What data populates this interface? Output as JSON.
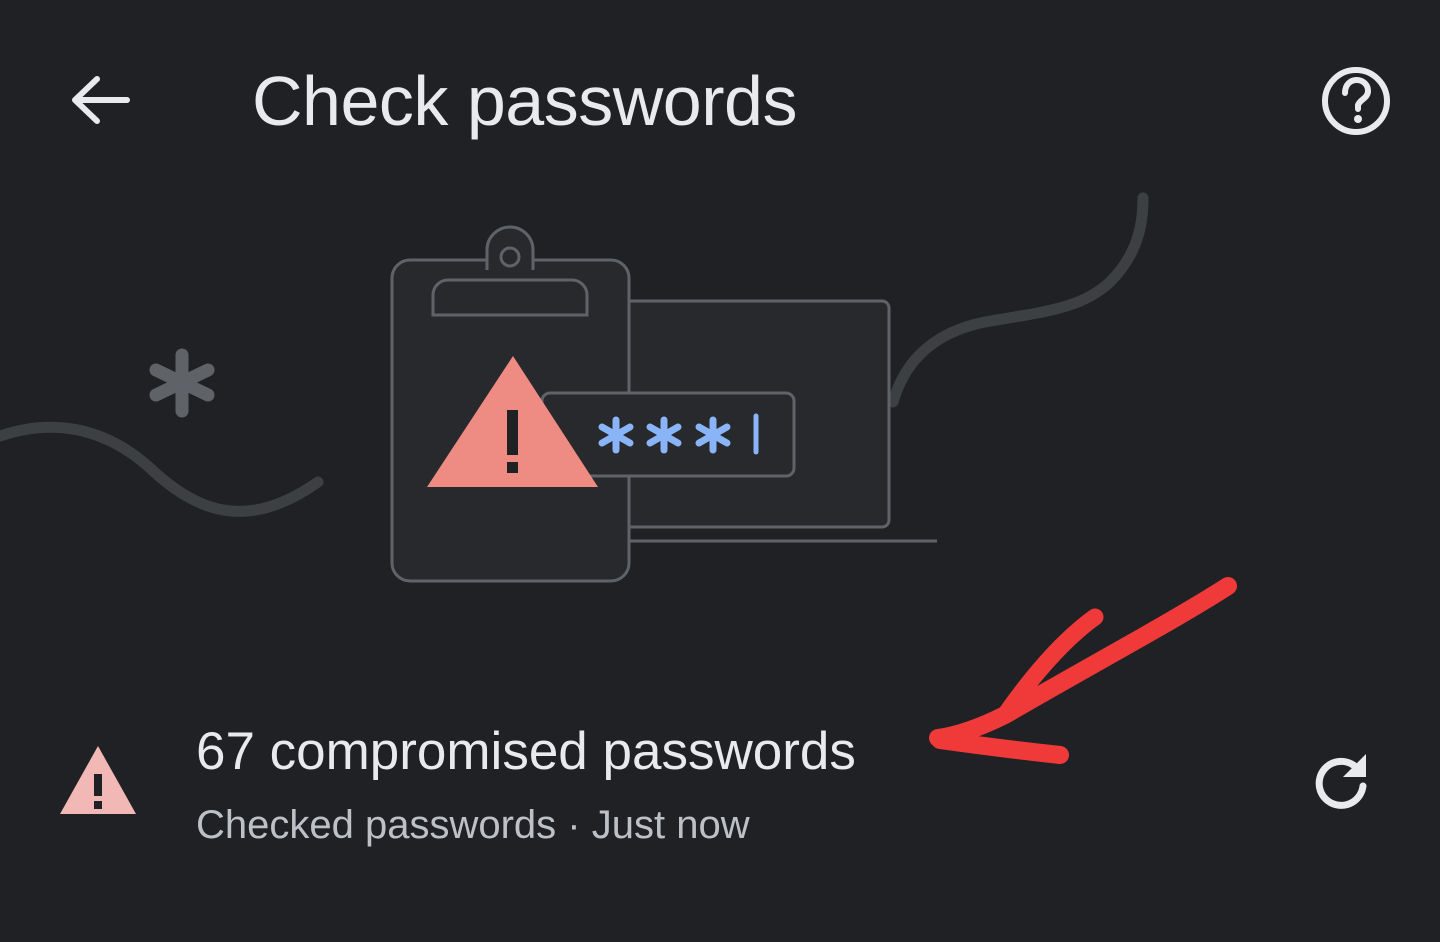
{
  "header": {
    "title": "Check passwords",
    "back_icon": "arrow-back-icon",
    "help_icon": "help-circle-icon"
  },
  "illustration": {
    "masked_password": "***",
    "accent_warning": "#ee8b82",
    "accent_password": "#8ab4f8"
  },
  "status": {
    "title": "67 compromised passwords",
    "subtitle": "Checked passwords · Just now",
    "warning_icon": "warning-triangle-icon",
    "refresh_icon": "refresh-icon",
    "warning_color": "#f2b8b5"
  },
  "annotation": {
    "arrow_color": "#f03a3a"
  }
}
